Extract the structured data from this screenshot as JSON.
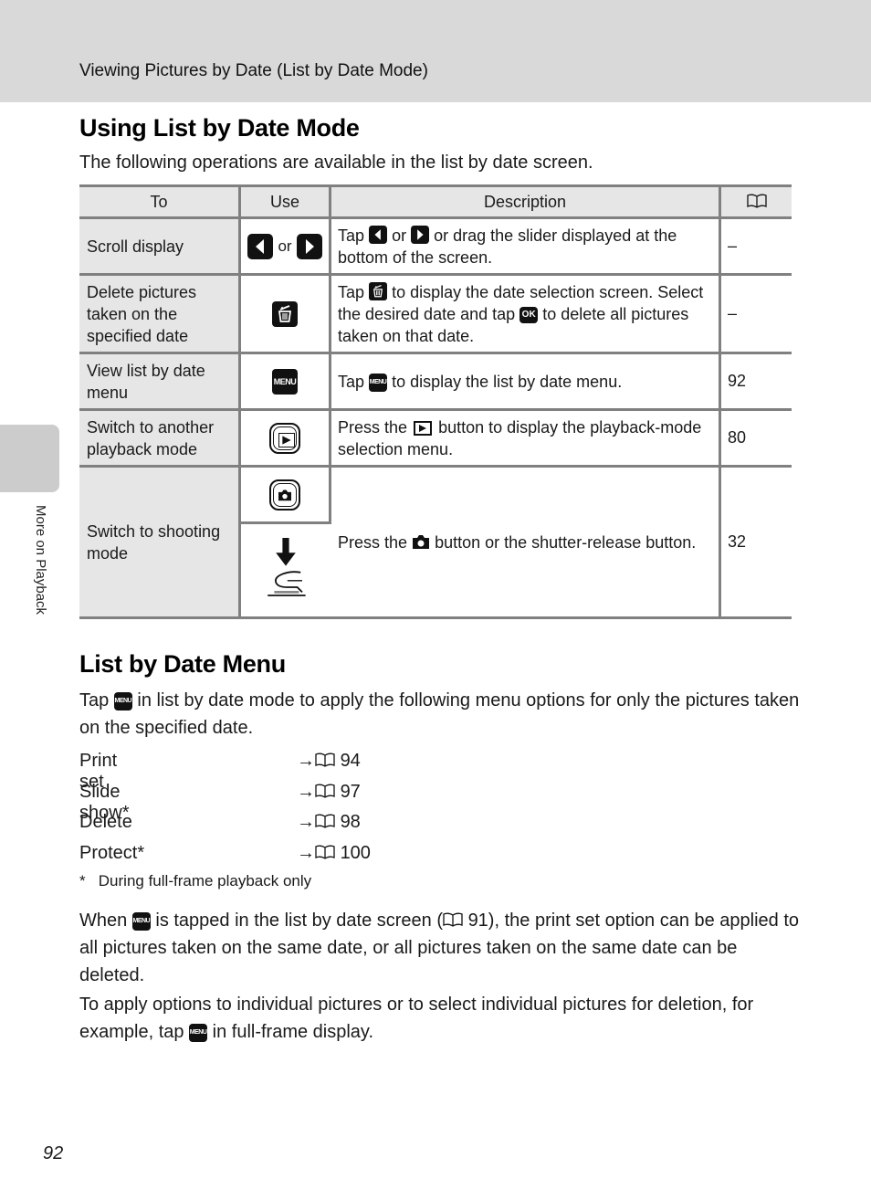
{
  "running_head": "Viewing Pictures by Date (List by Date Mode)",
  "side_tab_label": "More on Playback",
  "section1": {
    "title": "Using List by Date Mode",
    "intro": "The following operations are available in the list by date screen.",
    "table": {
      "headers": {
        "to": "To",
        "use": "Use",
        "description": "Description",
        "ref_icon": "book-icon"
      },
      "rows": [
        {
          "to": "Scroll display",
          "use_icons": [
            "left-arrow-button-icon",
            "right-arrow-button-icon"
          ],
          "use_or": "or",
          "desc_parts": [
            "Tap",
            "or",
            "or drag the slider displayed at the bottom of the screen."
          ],
          "ref": "–"
        },
        {
          "to": "Delete pictures taken on the specified date",
          "use_icons": [
            "trash-button-icon"
          ],
          "desc_parts": [
            "Tap",
            "to display the date selection screen. Select the desired date and tap",
            "to delete all pictures taken on that date."
          ],
          "ok_label": "OK",
          "ref": "–"
        },
        {
          "to": "View list by date menu",
          "use_icons": [
            "menu-button-icon"
          ],
          "menu_label": "MENU",
          "desc_parts": [
            "Tap",
            "to display the list by date menu."
          ],
          "ref": "92"
        },
        {
          "to": "Switch to another playback mode",
          "use_icons": [
            "playback-button-icon"
          ],
          "desc_parts": [
            "Press the",
            "button to display the playback-mode selection menu."
          ],
          "ref": "80"
        },
        {
          "to": "Switch to shooting mode",
          "use_icons": [
            "shooting-mode-button-icon",
            "shutter-release-press-icon"
          ],
          "desc_parts": [
            "Press the",
            "button or the shutter-release button."
          ],
          "ref": "32"
        }
      ]
    }
  },
  "section2": {
    "title": "List by Date Menu",
    "intro_parts": [
      "Tap",
      "in list by date mode to apply the following menu options for only the pictures taken on the specified date."
    ],
    "menu_items": [
      {
        "label": "Print set",
        "arrow": "→",
        "page": "94"
      },
      {
        "label": "Slide show*",
        "arrow": "→",
        "page": "97"
      },
      {
        "label": "Delete",
        "arrow": "→",
        "page": "98"
      },
      {
        "label": "Protect*",
        "arrow": "→",
        "page": "100"
      }
    ],
    "footnote": "*   During full-frame playback only",
    "para1_parts": [
      "When",
      "is tapped in the list by date screen (",
      "91), the print set option can be applied to all pictures taken on the same date, or all pictures taken on the same date can be deleted."
    ],
    "para2_parts": [
      "To apply options to individual pictures or to select individual pictures for deletion, for example, tap",
      "in full-frame display."
    ]
  },
  "page_number": "92",
  "colors": {
    "header_band": "#d9d9d9",
    "side_tab": "#cccccc",
    "table_border": "#808080",
    "table_shade": "#e6e6e6"
  }
}
